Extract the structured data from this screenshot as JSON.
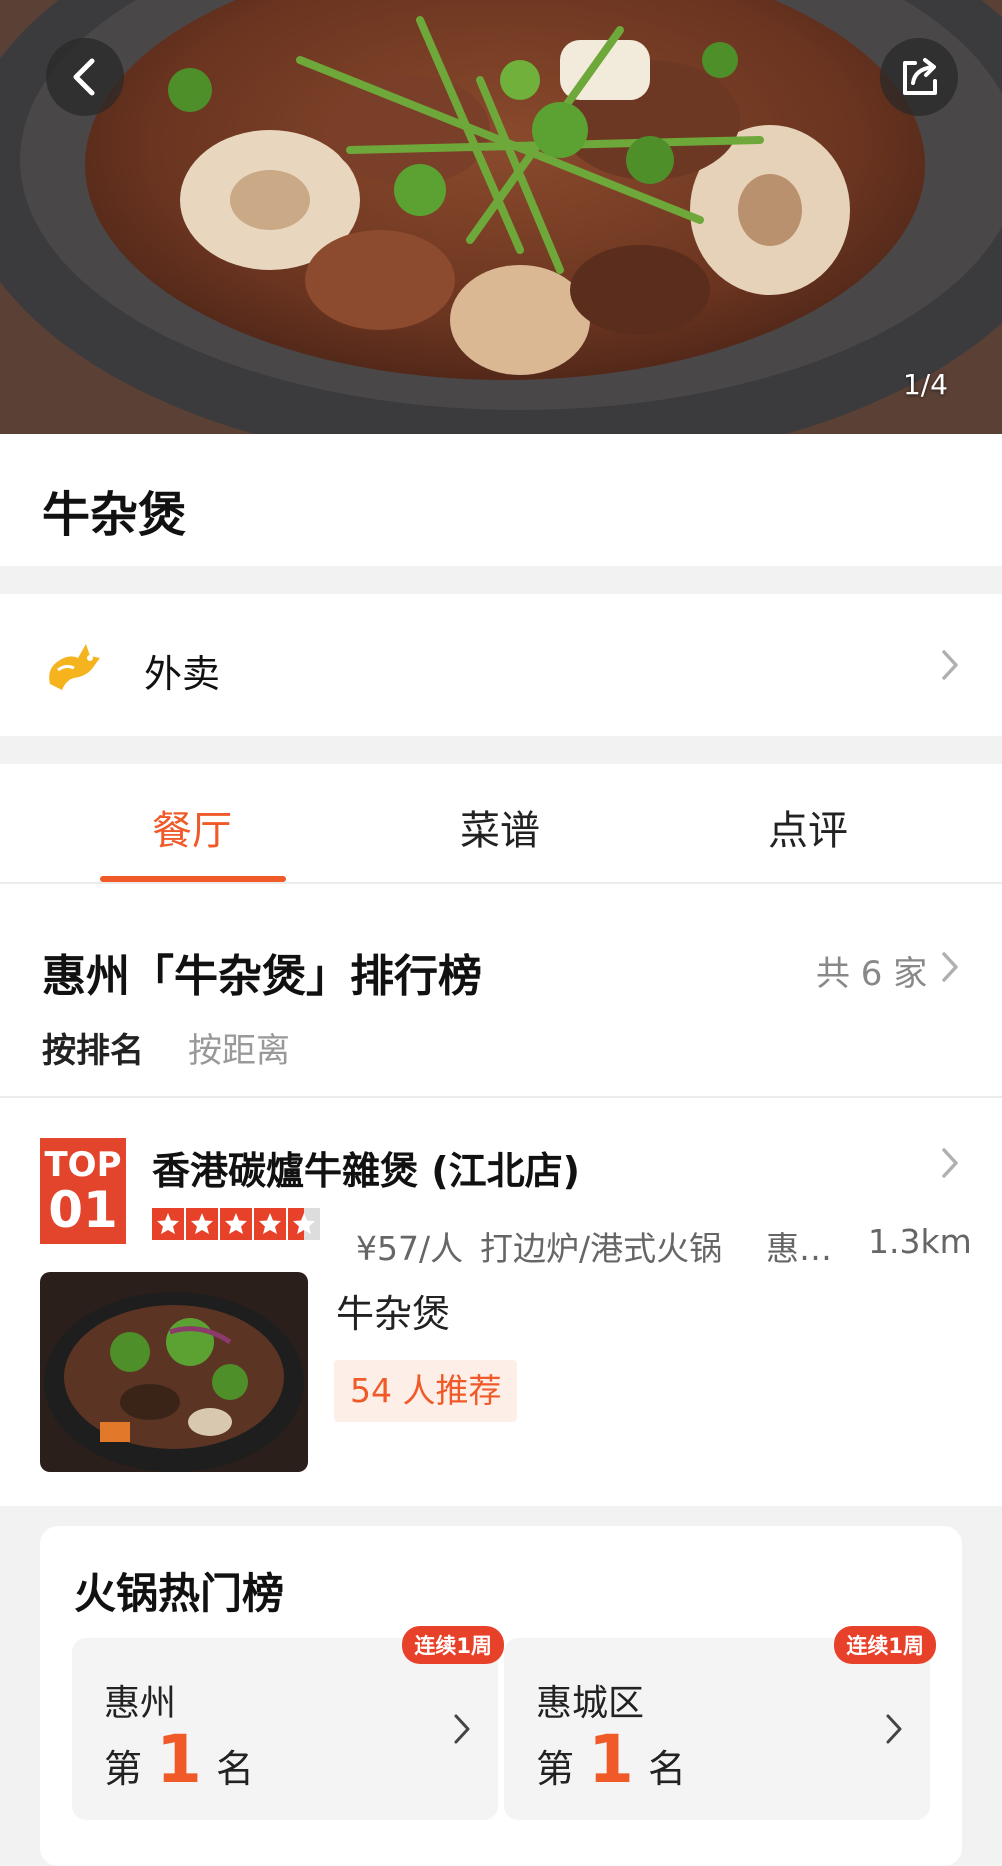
{
  "hero": {
    "photo_counter": "1/4"
  },
  "dish": {
    "title": "牛杂煲"
  },
  "takeout": {
    "label": "外卖"
  },
  "tabs": [
    {
      "label": "餐厅",
      "active": true
    },
    {
      "label": "菜谱",
      "active": false
    },
    {
      "label": "点评",
      "active": false
    }
  ],
  "ranking": {
    "title": "惠州「牛杂煲」排行榜",
    "total": "共 6 家",
    "sort_options": [
      {
        "label": "按排名",
        "active": true
      },
      {
        "label": "按距离",
        "active": false
      }
    ]
  },
  "restaurant": {
    "badge_top": "TOP",
    "badge_num": "01",
    "name": "香港碳爐牛雜煲 (江北店)",
    "rating_stars": 4.5,
    "price": "¥57/人",
    "category": "打边炉/港式火锅",
    "area": "惠…",
    "distance": "1.3km",
    "featured_dish": "牛杂煲",
    "recommend": "54 人推荐"
  },
  "hot_list": {
    "title": "火锅热门榜",
    "items": [
      {
        "area": "惠州",
        "prefix": "第",
        "rank": "1",
        "suffix": "名",
        "badge": "连续1周"
      },
      {
        "area": "惠城区",
        "prefix": "第",
        "rank": "1",
        "suffix": "名",
        "badge": "连续1周"
      }
    ]
  },
  "colors": {
    "accent": "#f05a28",
    "badge_red": "#e2442c",
    "star_bg": "#e8412a"
  },
  "icons": {
    "back": "chevron-left-icon",
    "share": "share-icon",
    "takeout": "delivery-kangaroo-icon",
    "arrow": "chevron-right-icon"
  }
}
